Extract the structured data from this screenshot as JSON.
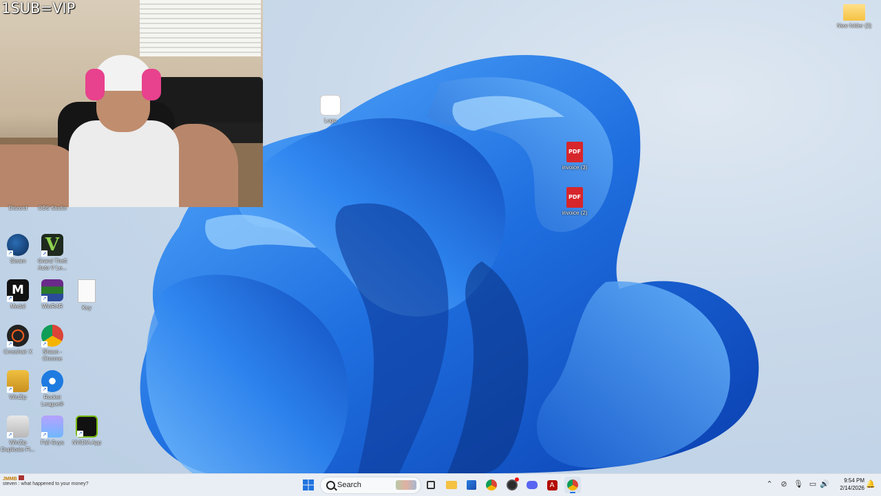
{
  "overlay_text": "1SUB=VIP",
  "desktop_icons": [
    {
      "id": "discord",
      "label": "Discord"
    },
    {
      "id": "obs",
      "label": "OBS Studio"
    },
    {
      "id": "steam",
      "label": "Steam"
    },
    {
      "id": "gta",
      "label": "Grand Theft Auto V Le..."
    },
    {
      "id": "medal",
      "label": "Medal"
    },
    {
      "id": "winrar",
      "label": "WinRAR"
    },
    {
      "id": "key",
      "label": "Key"
    },
    {
      "id": "crosshair",
      "label": "Crosshair X"
    },
    {
      "id": "chrome-shaun",
      "label": "Shaun - Chrome"
    },
    {
      "id": "winzip",
      "label": "WinZip"
    },
    {
      "id": "rocket",
      "label": "Rocket League®"
    },
    {
      "id": "winzip-dup",
      "label": "WinZip Duplicate Fi..."
    },
    {
      "id": "fallguys",
      "label": "Fall Guys"
    },
    {
      "id": "nvidia",
      "label": "NVIDIA App"
    },
    {
      "id": "logo",
      "label": "Logo"
    },
    {
      "id": "invoice3",
      "label": "invoice (3)"
    },
    {
      "id": "invoice2",
      "label": "invoice (2)"
    },
    {
      "id": "newfolder",
      "label": "New folder (2)"
    }
  ],
  "taskbar": {
    "chat_name": "JMMB",
    "chat_line": "steven : what happened to your money?",
    "search_placeholder": "Search",
    "time": "9:54 PM",
    "date": "2/14/2026",
    "pinned": [
      "Task View",
      "File Explorer",
      "Microsoft Store",
      "Google Chrome",
      "OBS Studio",
      "Discord",
      "Adobe Acrobat",
      "Google Chrome"
    ]
  },
  "colors": {
    "wallpaper_blue": "#1f6fe0",
    "taskbar_bg": "#e9eef4",
    "pdf_red": "#d7262b"
  }
}
